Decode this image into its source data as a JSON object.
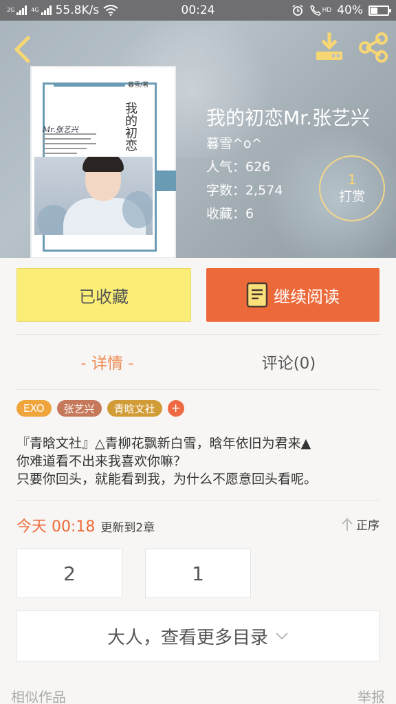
{
  "status_bar": {
    "net_type_1": "2G",
    "net_type_2": "4G",
    "speed": "55.8K/s",
    "time": "00:24",
    "hd_label": "HD",
    "battery": "40%",
    "battery_level": 0.4
  },
  "book": {
    "title": "我的初恋Mr.张艺兴",
    "author": "暮雪^o^",
    "popularity_label": "人气：",
    "popularity": "626",
    "words_label": "字数：",
    "words": "2,574",
    "favorites_label": "收藏：",
    "favorites": "6",
    "reward_count": "1",
    "reward_label": "打赏",
    "cover": {
      "author_mark": "暮雪/著",
      "title": "我的初恋",
      "mr_text": "Mr.张艺兴"
    }
  },
  "actions": {
    "favorited_label": "已收藏",
    "continue_label": "继续阅读"
  },
  "tabs": {
    "detail": "- 详情 -",
    "comments": "评论(0)"
  },
  "tags": [
    {
      "label": "EXO",
      "color": "#f0a43c"
    },
    {
      "label": "张艺兴",
      "color": "#c6785a"
    },
    {
      "label": "青晗文社",
      "color": "#d19b35"
    }
  ],
  "add_tag": "+",
  "description": {
    "line1": "『青晗文社』△青柳花飘新白雪，晗年依旧为君来▲",
    "line2": "你难道看不出来我喜欢你嘛？",
    "line3": "只要你回头，就能看到我，为什么不愿意回头看呢。"
  },
  "update": {
    "today": "今天 00:18",
    "text": "更新到2章",
    "sort_label": "正序"
  },
  "chapters": [
    "2",
    "1"
  ],
  "more_label": "大人，查看更多目录",
  "footer": {
    "similar": "相似作品",
    "report": "举报"
  },
  "colors": {
    "accent_orange": "#ec6a3a",
    "fav_yellow": "#fbee77",
    "reward_gold": "#f7d774"
  }
}
